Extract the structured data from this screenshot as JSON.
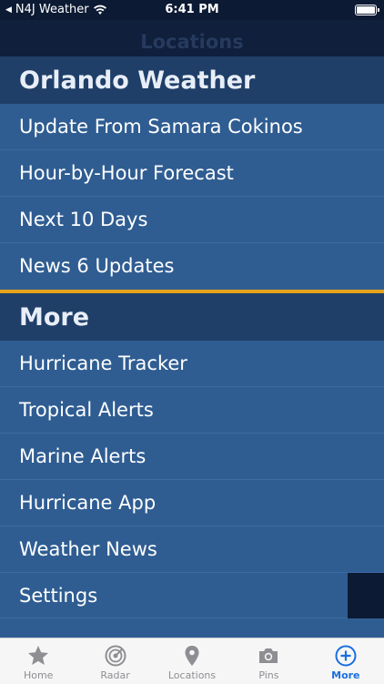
{
  "status": {
    "carrier": "N4J Weather",
    "time": "6:41 PM"
  },
  "nav": {
    "title": "Locations"
  },
  "sections": [
    {
      "title": "Orlando Weather",
      "items": [
        "Update From Samara Cokinos",
        "Hour-by-Hour Forecast",
        "Next 10 Days",
        "News 6 Updates"
      ]
    },
    {
      "title": "More",
      "items": [
        "Hurricane Tracker",
        "Tropical Alerts",
        "Marine Alerts",
        "Hurricane App",
        "Weather News",
        "Settings"
      ]
    }
  ],
  "tabs": [
    {
      "label": "Home",
      "icon": "star-icon"
    },
    {
      "label": "Radar",
      "icon": "radar-icon"
    },
    {
      "label": "Locations",
      "icon": "location-pin-icon"
    },
    {
      "label": "Pins",
      "icon": "camera-icon"
    },
    {
      "label": "More",
      "icon": "plus-circle-icon",
      "active": true
    }
  ],
  "colors": {
    "accent_divider": "#e3a21a",
    "row_bg": "#2f5d92",
    "header_bg": "#1f3f68",
    "active_tab": "#1a6fe0"
  }
}
